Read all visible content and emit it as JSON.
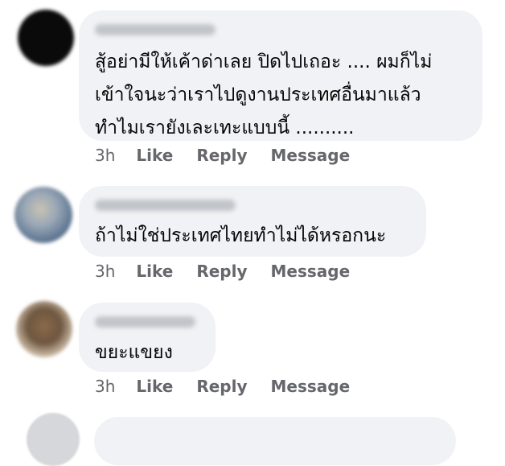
{
  "colors": {
    "bubble": "#f0f2f5",
    "text": "#050505",
    "meta": "#65676b"
  },
  "comments": [
    {
      "text": "สู้อย่ามีให้เค้าด่าเลย ปิดไปเถอะ .... ผมก็ไม่\nเข้าใจนะว่าเราไปดูงานประเทศอื่นมาแล้ว\nทำไมเรายังเละเทะแบบนี้ ..........",
      "time": "3h",
      "like": "Like",
      "reply": "Reply",
      "message": "Message"
    },
    {
      "text": "ถ้าไม่ใช่ประเทศไทยทำไม่ได้หรอกนะ",
      "time": "3h",
      "like": "Like",
      "reply": "Reply",
      "message": "Message"
    },
    {
      "text": "ขยะแขยง",
      "time": "3h",
      "like": "Like",
      "reply": "Reply",
      "message": "Message"
    }
  ]
}
